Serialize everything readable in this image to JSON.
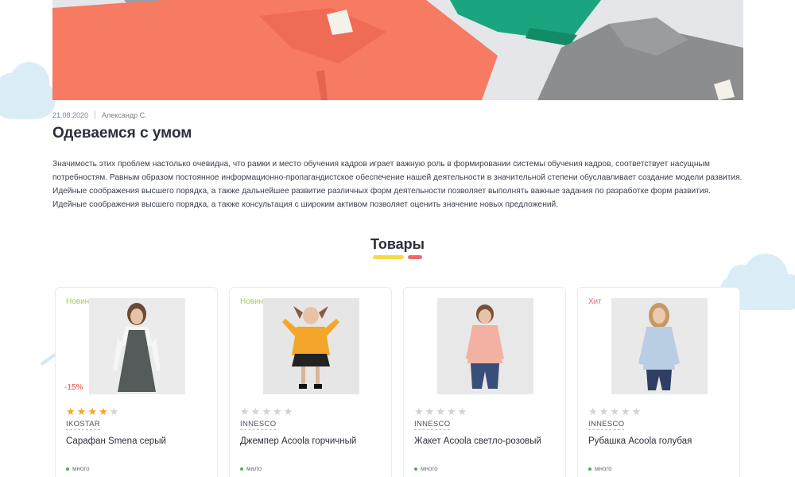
{
  "article": {
    "date": "21.08.2020",
    "author": "Александр С.",
    "title": "Одеваемся с умом",
    "paragraph": "Значимость этих проблем настолько очевидна, что рамки и место обучения кадров играет важную роль в формировании системы обучения кадров, соответствует насущным потребностям. Равным образом постоянное информационно-пропагандистское обеспечение нашей деятельности в значительной степени обуславливает создание модели развития. Идейные соображения высшего порядка, а также дальнейшее развитие различных форм деятельности позволяет выполнять важные задания по разработке форм развития. Идейные соображения высшего порядка, а также консультация с широким активом позволяет оценить значение новых предложений."
  },
  "products_section": {
    "title": "Товары",
    "accent_colors": [
      "#f7d94a",
      "#f06a6a"
    ]
  },
  "products": [
    {
      "badge": "Новинка",
      "badge_type": "new",
      "discount": "-15%",
      "rating": 4,
      "brand": "IKOSTAR",
      "name": "Сарафан Smena серый",
      "stock": "много"
    },
    {
      "badge": "Новинка",
      "badge_type": "new",
      "discount": "",
      "rating": 0,
      "brand": "INNESCO",
      "name": "Джемпер Acoola горчичный",
      "stock": "мало"
    },
    {
      "badge": "",
      "badge_type": "",
      "discount": "",
      "rating": 0,
      "brand": "INNESCO",
      "name": "Жакет Acoola светло-розовый",
      "stock": "много"
    },
    {
      "badge": "Хит",
      "badge_type": "hit",
      "discount": "",
      "rating": 0,
      "brand": "INNESCO",
      "name": "Рубашка Acoola голубая",
      "stock": "много"
    }
  ]
}
